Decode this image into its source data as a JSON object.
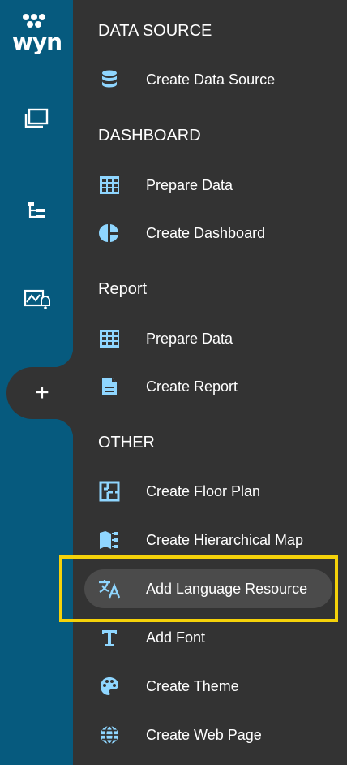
{
  "app": {
    "logo_text": "wyn",
    "accent_color": "#8fd6ff",
    "rail_color": "#065a7e",
    "panel_color": "#333333",
    "highlight_color": "#f5d20a"
  },
  "rail": {
    "items": [
      {
        "icon": "documents-icon"
      },
      {
        "icon": "hierarchy-icon"
      },
      {
        "icon": "monitor-alert-icon"
      },
      {
        "icon": "plus-icon",
        "label": "+"
      }
    ]
  },
  "sections": {
    "data_source": {
      "title": "DATA SOURCE",
      "items": [
        {
          "label": "Create Data Source",
          "icon": "database-icon"
        }
      ]
    },
    "dashboard": {
      "title": "DASHBOARD",
      "items": [
        {
          "label": "Prepare Data",
          "icon": "table-icon"
        },
        {
          "label": "Create Dashboard",
          "icon": "pie-chart-icon"
        }
      ]
    },
    "report": {
      "title": "Report",
      "items": [
        {
          "label": "Prepare Data",
          "icon": "table-icon"
        },
        {
          "label": "Create Report",
          "icon": "document-icon"
        }
      ]
    },
    "other": {
      "title": "OTHER",
      "items": [
        {
          "label": "Create Floor Plan",
          "icon": "floor-plan-icon"
        },
        {
          "label": "Create Hierarchical Map",
          "icon": "map-icon"
        },
        {
          "label": "Add Language Resource",
          "icon": "translate-icon",
          "highlighted": true
        },
        {
          "label": "Add Font",
          "icon": "font-icon"
        },
        {
          "label": "Create Theme",
          "icon": "palette-icon"
        },
        {
          "label": "Create Web Page",
          "icon": "globe-icon"
        }
      ]
    }
  }
}
